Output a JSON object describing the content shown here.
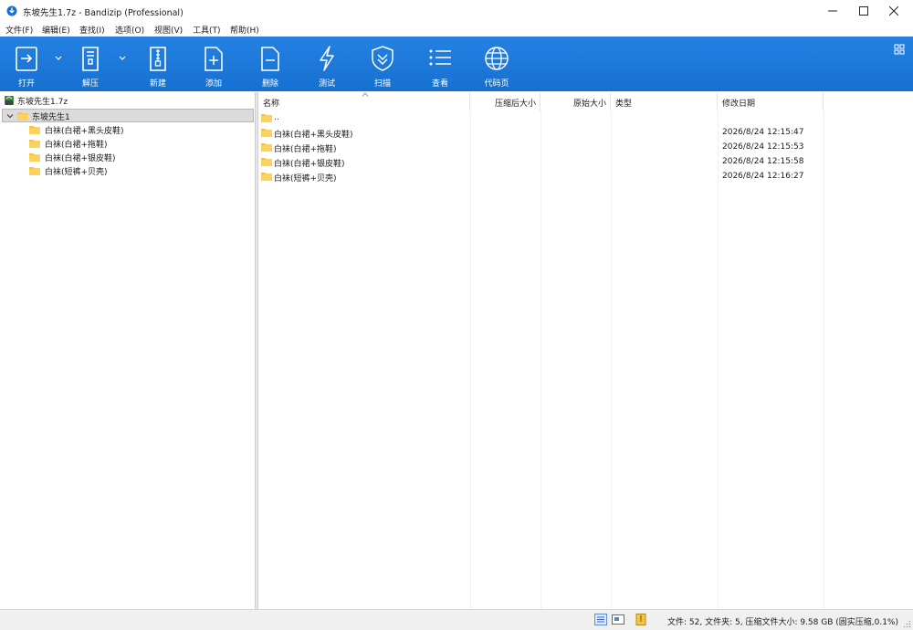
{
  "window": {
    "title": "东坡先生1.7z - Bandizip (Professional)",
    "controls": [
      "minimize",
      "maximize",
      "close"
    ]
  },
  "menu": [
    {
      "label": "文件(F)"
    },
    {
      "label": "编辑(E)"
    },
    {
      "label": "查找(I)"
    },
    {
      "label": "选项(O)"
    },
    {
      "label": "视图(V)"
    },
    {
      "label": "工具(T)"
    },
    {
      "label": "帮助(H)"
    }
  ],
  "toolbar": {
    "buttons": [
      {
        "label": "打开",
        "icon": "open-archive-icon"
      },
      {
        "label": "解压",
        "icon": "extract-icon"
      },
      {
        "label": "新建",
        "icon": "new-archive-icon"
      },
      {
        "label": "添加",
        "icon": "add-file-icon"
      },
      {
        "label": "删除",
        "icon": "delete-file-icon"
      },
      {
        "label": "测试",
        "icon": "test-lightning-icon"
      },
      {
        "label": "扫描",
        "icon": "scan-shield-icon"
      },
      {
        "label": "查看",
        "icon": "view-list-icon"
      },
      {
        "label": "代码页",
        "icon": "codepage-globe-icon"
      }
    ],
    "color": "#1c76d8"
  },
  "tree": {
    "root": "东坡先生1.7z",
    "selected": "东坡先生1",
    "children": [
      "白袜(白裙+黑头皮鞋)",
      "白袜(白裙+拖鞋)",
      "白袜(白裙+银皮鞋)",
      "白袜(短裤+贝壳)"
    ]
  },
  "list": {
    "columns": {
      "name": "名称",
      "compressed": "压缩后大小",
      "original": "原始大小",
      "type": "类型",
      "modified": "修改日期"
    },
    "rows": [
      {
        "name": "..",
        "date": ""
      },
      {
        "name": "白袜(白裙+黑头皮鞋)",
        "date": "2026/8/24 12:15:47"
      },
      {
        "name": "白袜(白裙+拖鞋)",
        "date": "2026/8/24 12:15:53"
      },
      {
        "name": "白袜(白裙+银皮鞋)",
        "date": "2026/8/24 12:15:58"
      },
      {
        "name": "白袜(短裤+贝壳)",
        "date": "2026/8/24 12:16:27"
      }
    ]
  },
  "status": {
    "text": "文件: 52, 文件夹: 5, 压缩文件大小: 9.58 GB (固实压缩,0.1%)"
  }
}
